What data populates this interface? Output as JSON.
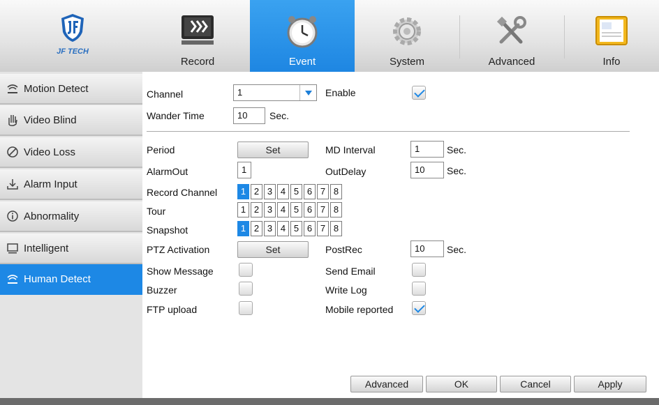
{
  "logo": {
    "text": "JF TECH"
  },
  "tabs": [
    {
      "label": "Record",
      "icon": "record-icon"
    },
    {
      "label": "Event",
      "icon": "alarm-clock-icon",
      "active": true
    },
    {
      "label": "System",
      "icon": "gear-icon"
    },
    {
      "label": "Advanced",
      "icon": "tools-icon"
    },
    {
      "label": "Info",
      "icon": "info-card-icon"
    }
  ],
  "sidebar": {
    "items": [
      {
        "label": "Motion Detect",
        "icon": "motion-icon"
      },
      {
        "label": "Video Blind",
        "icon": "hand-icon"
      },
      {
        "label": "Video Loss",
        "icon": "no-signal-icon"
      },
      {
        "label": "Alarm Input",
        "icon": "alarm-input-icon"
      },
      {
        "label": "Abnormality",
        "icon": "info-circle-icon"
      },
      {
        "label": "Intelligent",
        "icon": "monitor-icon"
      },
      {
        "label": "Human Detect",
        "icon": "motion-icon",
        "active": true
      }
    ]
  },
  "form": {
    "channel_label": "Channel",
    "channel_value": "1",
    "enable_label": "Enable",
    "enable_checked": true,
    "wander_label": "Wander Time",
    "wander_value": "10",
    "wander_unit": "Sec.",
    "period_label": "Period",
    "period_button": "Set",
    "md_interval_label": "MD Interval",
    "md_interval_value": "1",
    "md_interval_unit": "Sec.",
    "alarmout_label": "AlarmOut",
    "alarmout_value": "1",
    "outdelay_label": "OutDelay",
    "outdelay_value": "10",
    "outdelay_unit": "Sec.",
    "record_channel_label": "Record Channel",
    "record_channels": [
      "1",
      "2",
      "3",
      "4",
      "5",
      "6",
      "7",
      "8"
    ],
    "record_channels_on": [
      0
    ],
    "tour_label": "Tour",
    "tour_channels": [
      "1",
      "2",
      "3",
      "4",
      "5",
      "6",
      "7",
      "8"
    ],
    "tour_channels_on": [],
    "snapshot_label": "Snapshot",
    "snapshot_channels": [
      "1",
      "2",
      "3",
      "4",
      "5",
      "6",
      "7",
      "8"
    ],
    "snapshot_channels_on": [
      0
    ],
    "ptz_label": "PTZ Activation",
    "ptz_button": "Set",
    "postrec_label": "PostRec",
    "postrec_value": "10",
    "postrec_unit": "Sec.",
    "show_message_label": "Show Message",
    "show_message_checked": false,
    "send_email_label": "Send Email",
    "send_email_checked": false,
    "buzzer_label": "Buzzer",
    "buzzer_checked": false,
    "write_log_label": "Write Log",
    "write_log_checked": false,
    "ftp_label": "FTP upload",
    "ftp_checked": false,
    "mobile_label": "Mobile reported",
    "mobile_checked": true
  },
  "footer": {
    "advanced_label": "Advanced",
    "ok_label": "OK",
    "cancel_label": "Cancel",
    "apply_label": "Apply"
  },
  "colors": {
    "accent": "#1d88e5",
    "sidebar_bg": "#e4e4e4"
  }
}
